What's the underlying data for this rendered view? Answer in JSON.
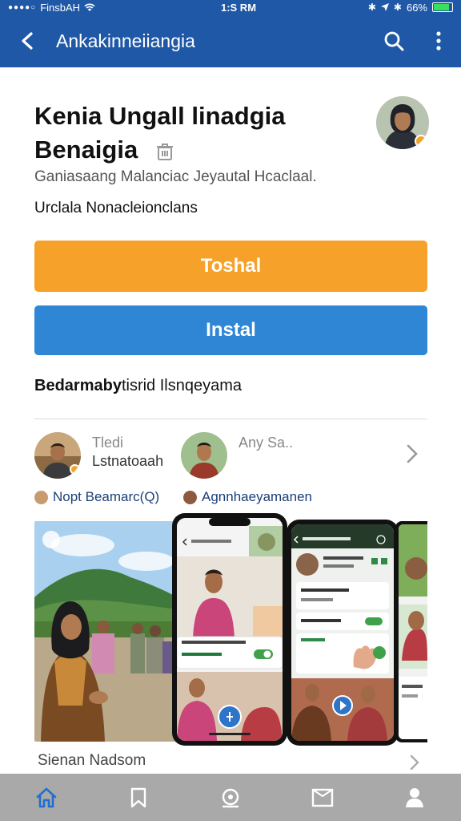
{
  "status_bar": {
    "carrier": "FinsbAH",
    "time": "1:S RM",
    "battery": "66%",
    "battery_level": 0.85
  },
  "app_bar": {
    "title": "Ankakinneiiangia",
    "back_icon": "back-arrow-icon",
    "search_icon": "search-icon",
    "menu_icon": "more-vert-icon"
  },
  "app": {
    "title_line1": "Kenia Ungall linadgia",
    "title_line2": "Benaigia",
    "subtitle": "Ganiasaang Malanciac Jeyautal Hcaclaal.",
    "category": "Urclala Nonacleionclans"
  },
  "buttons": {
    "primary_label": "Toshal",
    "install_label": "Instal"
  },
  "section": {
    "title_bold": "Bedarmaby",
    "title_rest": "tisrid Ilsnqeyama"
  },
  "reviewers": [
    {
      "name": "Tledi",
      "subtitle": "Lstnatoaah"
    },
    {
      "name": "Any Sa..",
      "subtitle": ""
    }
  ],
  "tags": [
    {
      "label": "Nopt Beamarc(Q)"
    },
    {
      "label": "Agnnhaeyamanen"
    }
  ],
  "screenshots": {
    "phone1_card_label": "Tilmwa Annacatl",
    "phone2_header": "Tdltsnnaoa wadanchaa",
    "phone2_row1": "Sitaa S toatamnea",
    "phone2_row2": "Eas Daamaaaalaatlt",
    "phone2_row3": "Kiltenrnmaanaal"
  },
  "footer": {
    "link": "Sienan Nadsom"
  },
  "bottom_nav": [
    {
      "icon": "home-icon"
    },
    {
      "icon": "bookmark-icon"
    },
    {
      "icon": "search-location-icon"
    },
    {
      "icon": "book-icon"
    },
    {
      "icon": "profile-icon"
    }
  ],
  "colors": {
    "brand_blue": "#1f58a6",
    "primary_orange": "#f6a129",
    "install_blue": "#2e86d4",
    "nav_gray": "#a9a9a9"
  }
}
